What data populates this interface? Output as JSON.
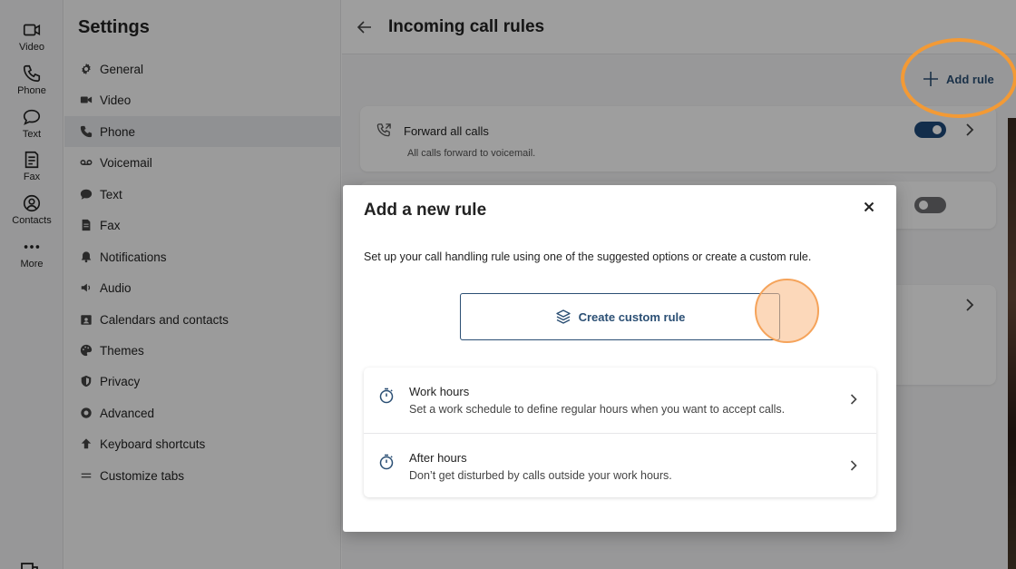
{
  "rail": {
    "items": [
      {
        "label": "Video",
        "icon": "video-icon"
      },
      {
        "label": "Phone",
        "icon": "phone-icon"
      },
      {
        "label": "Text",
        "icon": "chat-bubble-icon"
      },
      {
        "label": "Fax",
        "icon": "fax-icon"
      },
      {
        "label": "Contacts",
        "icon": "contacts-icon"
      },
      {
        "label": "More",
        "icon": "more-dots-icon"
      }
    ]
  },
  "settings": {
    "title": "Settings",
    "items": [
      {
        "label": "General",
        "icon": "gear-icon"
      },
      {
        "label": "Video",
        "icon": "video-camera-icon"
      },
      {
        "label": "Phone",
        "icon": "phone-icon"
      },
      {
        "label": "Voicemail",
        "icon": "voicemail-icon"
      },
      {
        "label": "Text",
        "icon": "chat-bubble-icon"
      },
      {
        "label": "Fax",
        "icon": "fax-icon"
      },
      {
        "label": "Notifications",
        "icon": "bell-icon"
      },
      {
        "label": "Audio",
        "icon": "speaker-icon"
      },
      {
        "label": "Calendars and contacts",
        "icon": "calendar-contact-icon"
      },
      {
        "label": "Themes",
        "icon": "palette-icon"
      },
      {
        "label": "Privacy",
        "icon": "shield-icon"
      },
      {
        "label": "Advanced",
        "icon": "advanced-gear-icon"
      },
      {
        "label": "Keyboard shortcuts",
        "icon": "keyboard-icon"
      },
      {
        "label": "Customize tabs",
        "icon": "lines-icon"
      }
    ],
    "active_item": "Phone"
  },
  "main": {
    "title": "Incoming call rules",
    "add_rule_label": "Add rule",
    "rules": [
      {
        "title": "Forward all calls",
        "subtitle": "All calls forward to voicemail.",
        "enabled": true
      }
    ]
  },
  "modal": {
    "title": "Add a new rule",
    "description": "Set up your call handling rule using one of the suggested options or create a custom rule.",
    "custom_button_label": "Create custom rule",
    "options": [
      {
        "title": "Work hours",
        "subtitle": "Set a work schedule to define regular hours when you want to accept calls."
      },
      {
        "title": "After hours",
        "subtitle": "Don’t get disturbed by calls outside your work hours."
      }
    ]
  },
  "colors": {
    "accent": "#2b4f74",
    "toggle_on": "#1e4a7a",
    "annotation": "#f39a35"
  }
}
